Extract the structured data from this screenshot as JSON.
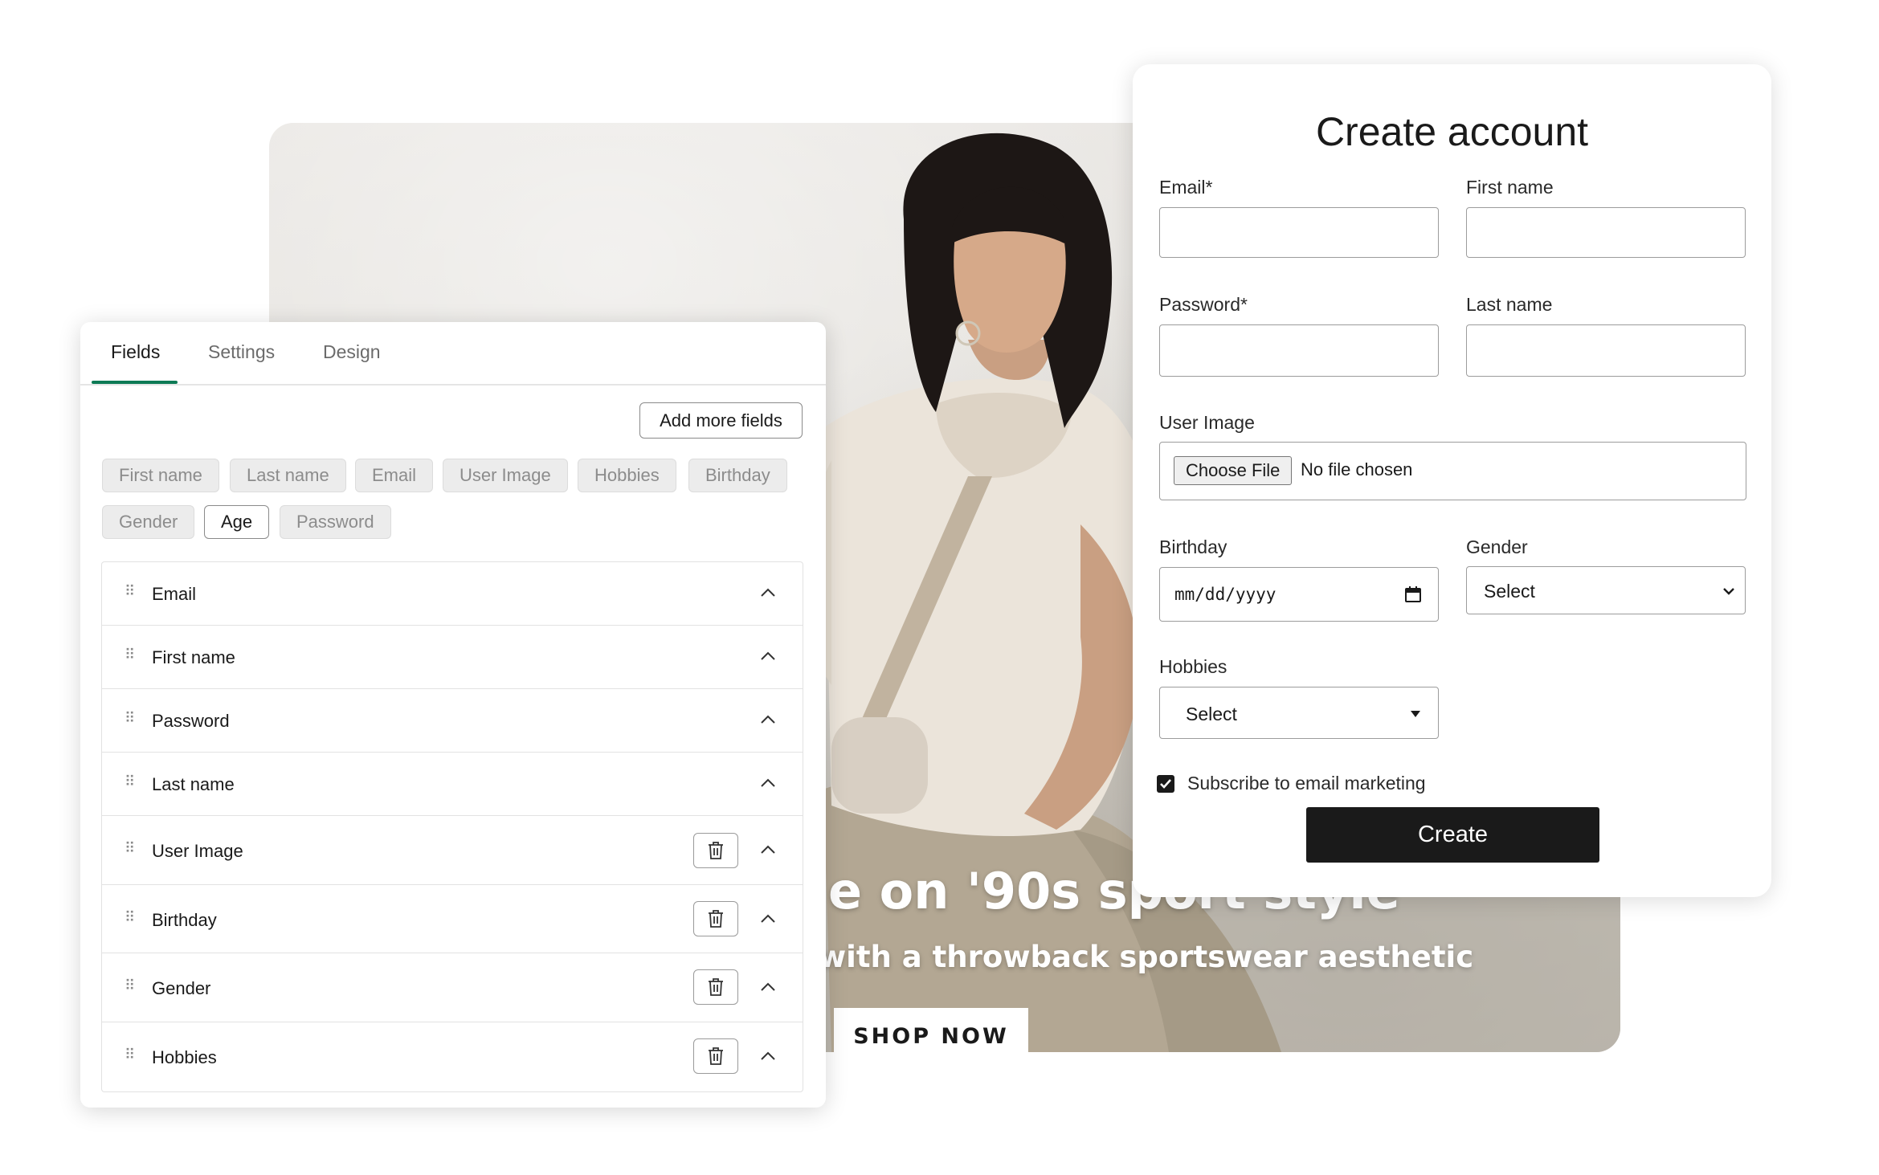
{
  "hero": {
    "headline": "e on '90s sport style",
    "subheadline": "with a throwback sportswear aesthetic",
    "cta_label": "SHOP NOW"
  },
  "editor": {
    "tabs": [
      {
        "label": "Fields",
        "active": true
      },
      {
        "label": "Settings",
        "active": false
      },
      {
        "label": "Design",
        "active": false
      }
    ],
    "add_more_label": "Add more fields",
    "chips": [
      {
        "label": "First name",
        "selected": false
      },
      {
        "label": "Last name",
        "selected": false
      },
      {
        "label": "Email",
        "selected": false
      },
      {
        "label": "User Image",
        "selected": false
      },
      {
        "label": "Hobbies",
        "selected": false
      },
      {
        "label": "Birthday",
        "selected": false
      },
      {
        "label": "Gender",
        "selected": false
      },
      {
        "label": "Age",
        "selected": true
      },
      {
        "label": "Password",
        "selected": false
      }
    ],
    "fields": [
      {
        "label": "Email",
        "deletable": false
      },
      {
        "label": "First name",
        "deletable": false
      },
      {
        "label": "Password",
        "deletable": false
      },
      {
        "label": "Last name",
        "deletable": false
      },
      {
        "label": "User Image",
        "deletable": true
      },
      {
        "label": "Birthday",
        "deletable": true
      },
      {
        "label": "Gender",
        "deletable": true
      },
      {
        "label": "Hobbies",
        "deletable": true
      }
    ]
  },
  "form": {
    "title": "Create account",
    "email_label": "Email*",
    "first_name_label": "First name",
    "password_label": "Password*",
    "last_name_label": "Last name",
    "user_image_label": "User Image",
    "choose_file_label": "Choose File",
    "no_file_text": "No file chosen",
    "birthday_label": "Birthday",
    "birthday_placeholder": "mm/dd/yyyy",
    "gender_label": "Gender",
    "gender_value": "Select",
    "hobbies_label": "Hobbies",
    "hobbies_value": "Select",
    "subscribe_label": "Subscribe to email marketing",
    "subscribe_checked": true,
    "create_label": "Create"
  },
  "colors": {
    "accent": "#0d7a55",
    "button_dark": "#1a1a1a"
  }
}
